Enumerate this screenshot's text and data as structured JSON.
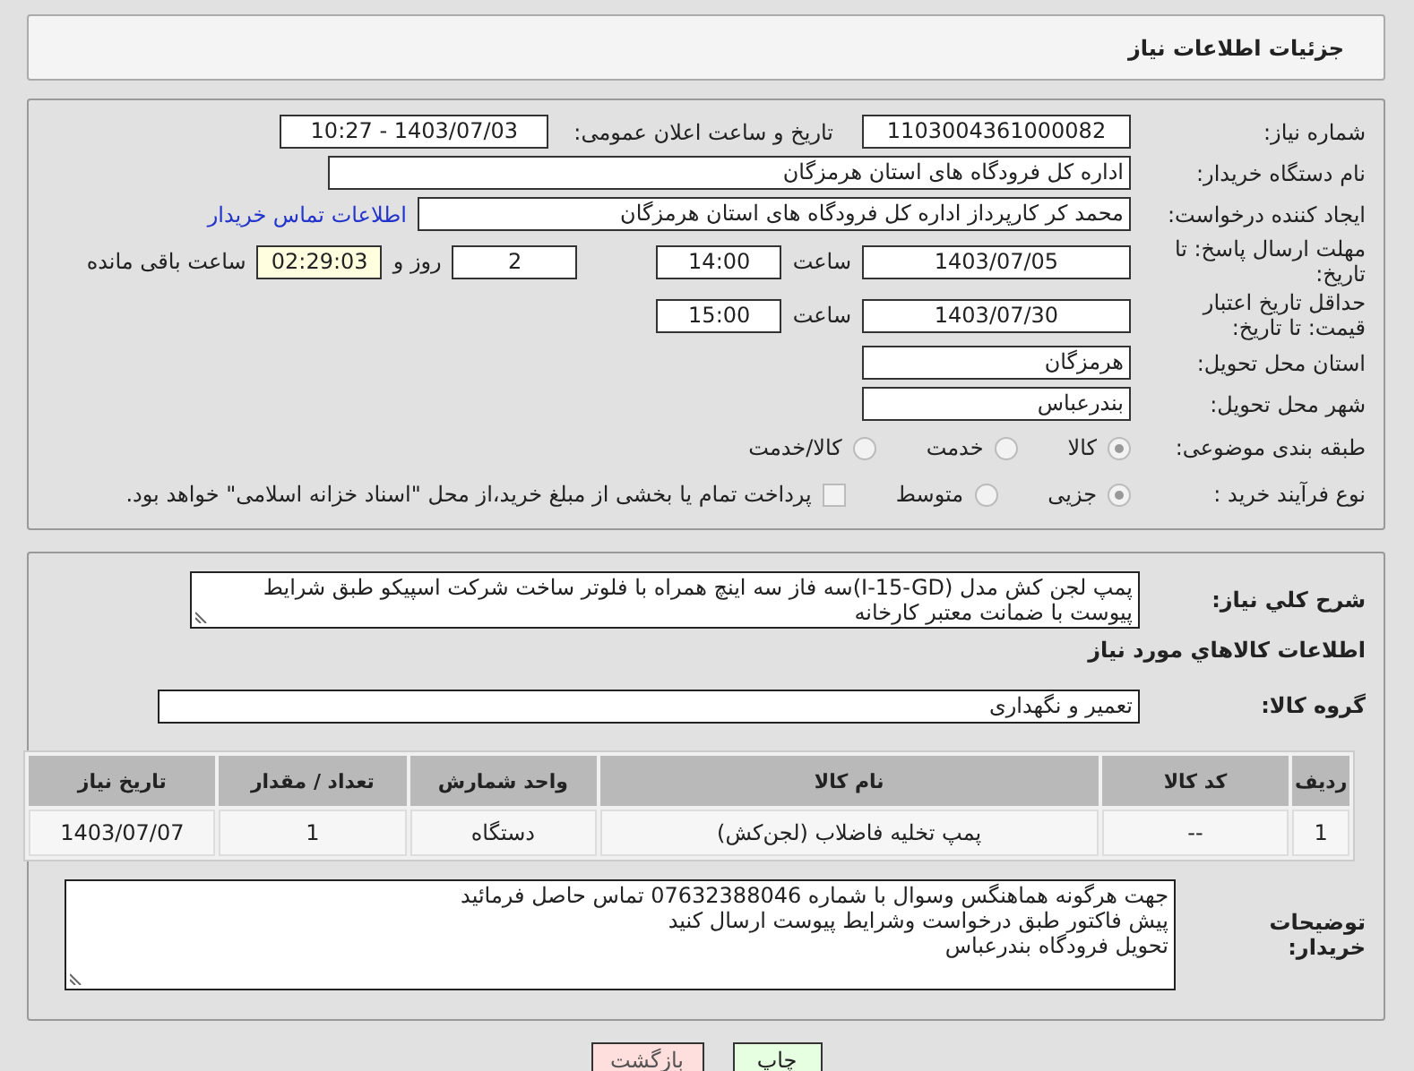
{
  "header": {
    "title": "جزئیات اطلاعات نیاز"
  },
  "need_number": {
    "label": "شماره نیاز:",
    "value": "1103004361000082"
  },
  "announce": {
    "label": "تاریخ و ساعت اعلان عمومی:",
    "value": "1403/07/03 - 10:27"
  },
  "buyer_org": {
    "label": "نام دستگاه خریدار:",
    "value": "اداره کل فرودگاه های استان هرمزگان"
  },
  "requester": {
    "label": "ایجاد کننده درخواست:",
    "value": "محمد کر کارپرداز اداره کل فرودگاه های استان هرمزگان",
    "link": "اطلاعات تماس خریدار"
  },
  "reply_deadline": {
    "label": "مهلت ارسال پاسخ: تا تاریخ:",
    "date": "1403/07/05",
    "time_label": "ساعت",
    "time": "14:00",
    "days": "2",
    "days_label": "روز و",
    "remaining": "02:29:03",
    "remaining_label": "ساعت باقی مانده"
  },
  "price_validity": {
    "label": "حداقل تاریخ اعتبار قیمت: تا تاریخ:",
    "date": "1403/07/30",
    "time_label": "ساعت",
    "time": "15:00"
  },
  "province": {
    "label": "استان محل تحویل:",
    "value": "هرمزگان"
  },
  "city": {
    "label": "شهر محل تحویل:",
    "value": "بندرعباس"
  },
  "category": {
    "label": "طبقه بندی موضوعی:",
    "options": [
      {
        "label": "کالا",
        "selected": true
      },
      {
        "label": "خدمت",
        "selected": false
      },
      {
        "label": "کالا/خدمت",
        "selected": false
      }
    ]
  },
  "purchase_type": {
    "label": "نوع فرآیند خرید :",
    "options": [
      {
        "label": "جزیی",
        "selected": true
      },
      {
        "label": "متوسط",
        "selected": false
      }
    ],
    "payment": {
      "label": "پرداخت تمام یا بخشی از مبلغ خرید،از محل \"اسناد خزانه اسلامی\" خواهد بود.",
      "checked": false
    }
  },
  "description": {
    "label": "شرح کلي نياز:",
    "value": "پمپ لجن کش مدل (I-15-GD)سه فاز سه اینچ همراه با فلوتر ساخت شرکت اسپیکو طبق شرایط پیوست با ضمانت معتبر کارخانه"
  },
  "goods_title": "اطلاعات کالاهاي مورد نياز",
  "goods_group": {
    "label": "گروه کالا:",
    "value": "تعمیر و نگهداری"
  },
  "table": {
    "columns": [
      "ردیف",
      "کد کالا",
      "نام کالا",
      "واحد شمارش",
      "تعداد / مقدار",
      "تاریخ نیاز"
    ],
    "rows": [
      [
        "1",
        "--",
        "پمپ تخلیه فاضلاب (لجن‌کش)",
        "دستگاه",
        "1",
        "1403/07/07"
      ]
    ]
  },
  "buyer_notes": {
    "label": "توضیحات خریدار:",
    "lines": [
      "جهت هرگونه هماهنگس وسوال با شماره 07632388046 تماس حاصل فرمائید",
      "پیش فاکتور طبق درخواست وشرایط پیوست ارسال کنید",
      "تحویل فرودگاه بندرعباس"
    ]
  },
  "buttons": [
    {
      "label": "چاپ",
      "kind": "print"
    },
    {
      "label": "بازگشت",
      "kind": "back"
    }
  ]
}
